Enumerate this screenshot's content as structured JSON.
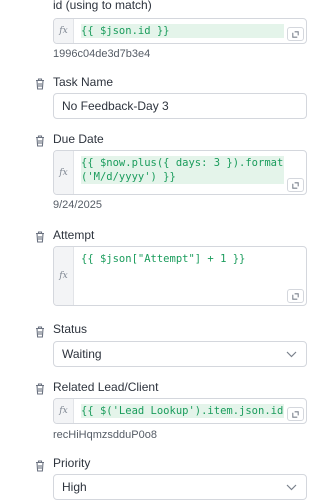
{
  "fields": {
    "id_match": {
      "label": "id (using to match)",
      "expression": "{{ $json.id }}",
      "resolved": "1996c04de3d7b3e4"
    },
    "task_name": {
      "label": "Task Name",
      "value": "No Feedback-Day 3"
    },
    "due_date": {
      "label": "Due Date",
      "expression": "{{ $now.plus({ days: 3 }).format\n('M/d/yyyy') }}",
      "resolved": "9/24/2025"
    },
    "attempt": {
      "label": "Attempt",
      "expression": "{{ $json[\"Attempt\"] + 1 }}"
    },
    "status": {
      "label": "Status",
      "value": "Waiting"
    },
    "related_lead": {
      "label": "Related Lead/Client",
      "expression": "{{ $('Lead Lookup').item.json.id }}",
      "resolved": "recHiHqmzsdduP0o8"
    },
    "priority": {
      "label": "Priority",
      "value": "High"
    }
  },
  "fx_label": "fx",
  "icons": {
    "delete": "trash-icon",
    "expand": "expand-icon",
    "dropdown": "chevron-down-icon"
  }
}
